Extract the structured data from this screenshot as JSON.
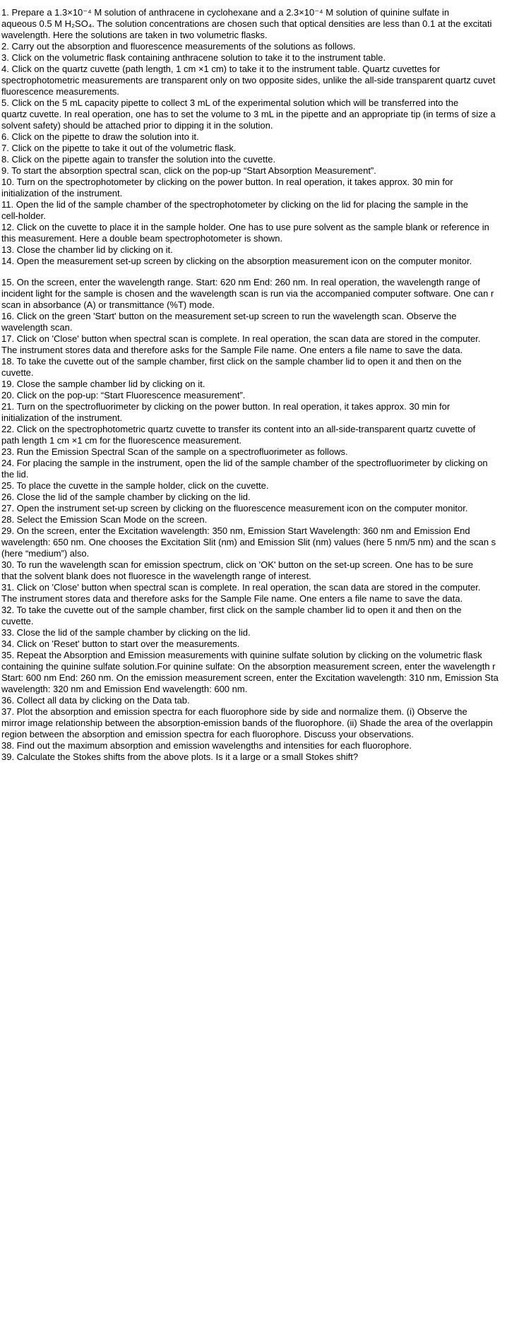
{
  "steps": [
    [
      "1. Prepare a 1.3×10⁻⁴ M solution of anthracene in cyclohexane and a 2.3×10⁻⁴ M solution of quinine sulfate in",
      "aqueous 0.5 M H₂SO₄. The solution concentrations are chosen such that optical densities are less than 0.1 at the excitati",
      "wavelength. Here the solutions are taken in two volumetric flasks."
    ],
    [
      "2. Carry out the absorption and fluorescence measurements of the solutions as follows."
    ],
    [
      "3. Click on the volumetric flask containing anthracene solution to take it to the instrument table."
    ],
    [
      "4. Click on the quartz cuvette (path length, 1 cm ×1 cm) to take it to the instrument table. Quartz cuvettes for",
      "spectrophotometric measurements are transparent only on two opposite sides, unlike the all-side transparent quartz cuvet",
      "fluorescence measurements."
    ],
    [
      "5. Click on the 5 mL capacity pipette to collect 3 mL of the experimental solution which will be transferred into the",
      "quartz cuvette. In real operation, one has to set the volume to 3 mL in the  pipette and an appropriate tip (in terms of size a",
      "solvent safety) should be attached prior to dipping it in the solution."
    ],
    [
      "6. Click on the pipette to draw the solution into it."
    ],
    [
      "7. Click on the pipette to take it out of the volumetric flask."
    ],
    [
      "8. Click on the pipette again to transfer the solution into the cuvette."
    ],
    [
      "9. To start the absorption spectral scan, click on the pop-up “Start Absorption Measurement”."
    ],
    [
      "10. Turn on the spectrophotometer by clicking on the power button. In real operation, it takes approx. 30 min for",
      "initialization of the instrument."
    ],
    [
      "11. Open the lid of the sample chamber of the spectrophotometer by clicking on the lid for placing the sample in the",
      "cell-holder."
    ],
    [
      "12. Click on the cuvette to place it in the sample holder. One has to use pure solvent as the sample blank or reference in",
      "this measurement. Here a double beam spectrophotometer is shown."
    ],
    [
      "13. Close the chamber lid by clicking on it."
    ],
    [
      "14. Open the measurement set-up screen by clicking on the absorption measurement icon on the computer monitor."
    ],
    [
      "15. On the screen, enter the wavelength range. Start: 620 nm End: 260 nm. In real operation, the wavelength range of",
      "incident light for the sample is chosen and the wavelength scan is run via the accompanied computer software. One can r",
      "scan in absorbance (A) or transmittance (%T) mode."
    ],
    [
      "16. Click on the green 'Start' button on the measurement set-up screen to run the wavelength scan. Observe the",
      "wavelength scan."
    ],
    [
      "17. Click on 'Close' button when spectral scan is complete. In real operation, the scan data are stored in the computer.",
      "The instrument stores data and therefore asks for the Sample File name. One enters a file name to save the data."
    ],
    [
      "18. To take the cuvette out of the sample chamber, first click on the sample chamber lid to open it and then on the",
      "cuvette."
    ],
    [
      "19. Close the sample chamber lid by clicking on it."
    ],
    [
      "20. Click on the pop-up: “Start Fluorescence measurement”."
    ],
    [
      "21. Turn on the spectrofluorimeter by clicking on the power button. In real operation, it takes approx. 30 min for",
      "initialization of the instrument."
    ],
    [
      "22. Click on the spectrophotometric quartz cuvette to transfer its content into an all-side-transparent quartz cuvette of",
      "path length 1 cm ×1 cm for the fluorescence measurement."
    ],
    [
      "23. Run the Emission Spectral Scan of the sample on a spectrofluorimeter as follows."
    ],
    [
      "24. For placing the sample in the instrument, open the lid of the sample chamber of the spectrofluorimeter by clicking on",
      "the lid."
    ],
    [
      "25. To place the cuvette in the sample holder, click on the cuvette."
    ],
    [
      "26. Close the lid of the sample chamber by clicking on the lid."
    ],
    [
      "27. Open the instrument set-up screen by clicking on the fluorescence measurement icon on the computer monitor."
    ],
    [
      "28. Select the Emission Scan Mode on the screen."
    ],
    [
      "29. On the screen, enter the Excitation wavelength: 350 nm, Emission Start Wavelength: 360 nm and Emission End",
      "wavelength: 650 nm. One chooses the Excitation Slit (nm) and Emission Slit (nm) values (here 5 nm/5 nm) and the scan s",
      "(here “medium”) also."
    ],
    [
      "30. To run the wavelength scan for emission spectrum, click on 'OK' button on the set-up screen. One has to be sure",
      "that the solvent blank does not fluoresce in the wavelength range of interest."
    ],
    [
      "31. Click on 'Close' button when spectral scan is complete. In real operation, the scan data are stored in the computer.",
      "The instrument stores data and therefore asks for the Sample File name. One enters a file name to save the data."
    ],
    [
      "32. To take the cuvette out of the sample chamber, first click on the sample chamber lid to open it and then on the",
      "cuvette."
    ],
    [
      "33. Close the lid of the sample chamber by clicking on the lid."
    ],
    [
      "34. Click on 'Reset' button to start over the measurements."
    ],
    [
      "35. Repeat the Absorption and Emission measurements with quinine sulfate solution by clicking on the volumetric flask",
      "containing the quinine sulfate solution.For quinine sulfate: On the absorption measurement screen, enter the wavelength r",
      "Start: 600 nm End: 260 nm. On the emission measurement screen, enter the Excitation wavelength: 310 nm, Emission Sta",
      "wavelength: 320 nm and Emission End wavelength: 600 nm."
    ],
    [
      "36. Collect all data by clicking on the Data tab."
    ],
    [
      "37. Plot the absorption and emission spectra for each fluorophore side by side and normalize them. (i) Observe the",
      "mirror image relationship between the absorption-emission bands of the fluorophore. (ii) Shade the area of the overlappin",
      "region between the absorption and emission spectra for each fluorophore. Discuss your observations."
    ],
    [
      "38. Find out the maximum absorption and emission wavelengths and intensities for each fluorophore."
    ],
    [
      "39. Calculate the Stokes shifts from the above plots. Is it a large or a small Stokes shift?"
    ]
  ]
}
